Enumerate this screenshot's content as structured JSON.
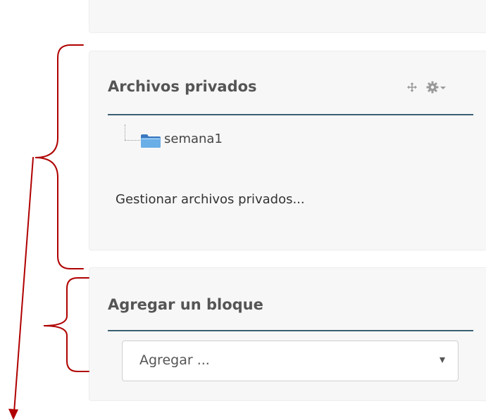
{
  "private_files_block": {
    "title": "Archivos privados",
    "folder_name": "semana1",
    "manage_link": "Gestionar archivos privados..."
  },
  "add_block": {
    "title": "Agregar un bloque",
    "select_value": "Agregar ..."
  },
  "icons": {
    "move": "move-icon",
    "gear": "gear-icon",
    "folder": "folder-icon",
    "dropdown": "chevron-down-icon"
  },
  "colors": {
    "card_background": "#f7f7f7",
    "title_text": "#555555",
    "rule": "#3b5f73",
    "annotation": "#b00000",
    "folder": "#4a86c8"
  }
}
